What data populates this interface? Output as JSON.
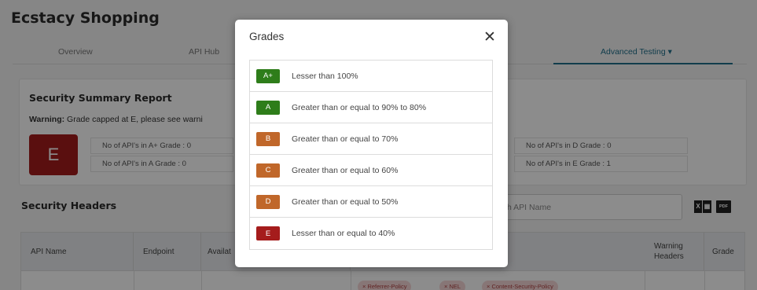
{
  "app": {
    "title": "Ecstacy Shopping"
  },
  "tabs": [
    {
      "label": "Overview"
    },
    {
      "label": "API Hub"
    },
    {
      "label": "Advanced Testing ▾"
    }
  ],
  "summary": {
    "title": "Security Summary Report",
    "warning_label": "Warning:",
    "warning_text": "Grade capped at E, please see warni",
    "overall_grade": "E",
    "counts": [
      "No of API's in A+ Grade : 0",
      "No of API's in A Grade : 0",
      "No of API's in D Grade : 0",
      "No of API's in E Grade : 1"
    ]
  },
  "security_headers": {
    "title": "Security Headers",
    "search_placeholder": "h API Name",
    "excel_icon": "excel-export-icon",
    "pdf_icon": "pdf-export-icon",
    "pdf_text": "PDF",
    "columns": [
      "API Name",
      "Endpoint",
      "Availat",
      "Warning Headers",
      "Grade"
    ],
    "row_pills": [
      "× Referrer-Policy",
      "× NEL",
      "× Content-Security-Policy"
    ]
  },
  "modal": {
    "title": "Grades",
    "close_label": "✕",
    "grades": [
      {
        "grade": "A+",
        "description": "Lesser than 100%",
        "color": "#2e7d1a"
      },
      {
        "grade": "A",
        "description": "Greater than or equal to 90% to 80%",
        "color": "#2e7d1a"
      },
      {
        "grade": "B",
        "description": "Greater than or equal to 70%",
        "color": "#c0672a"
      },
      {
        "grade": "C",
        "description": "Greater than or equal to 60%",
        "color": "#c0672a"
      },
      {
        "grade": "D",
        "description": "Greater than or equal to 50%",
        "color": "#c0672a"
      },
      {
        "grade": "E",
        "description": "Lesser than or equal to 40%",
        "color": "#a51c1c"
      }
    ]
  },
  "colors": {
    "accent": "#1f6f8b",
    "grade_e": "#a51c1c",
    "grade_green": "#2e7d1a",
    "grade_orange": "#c0672a"
  }
}
